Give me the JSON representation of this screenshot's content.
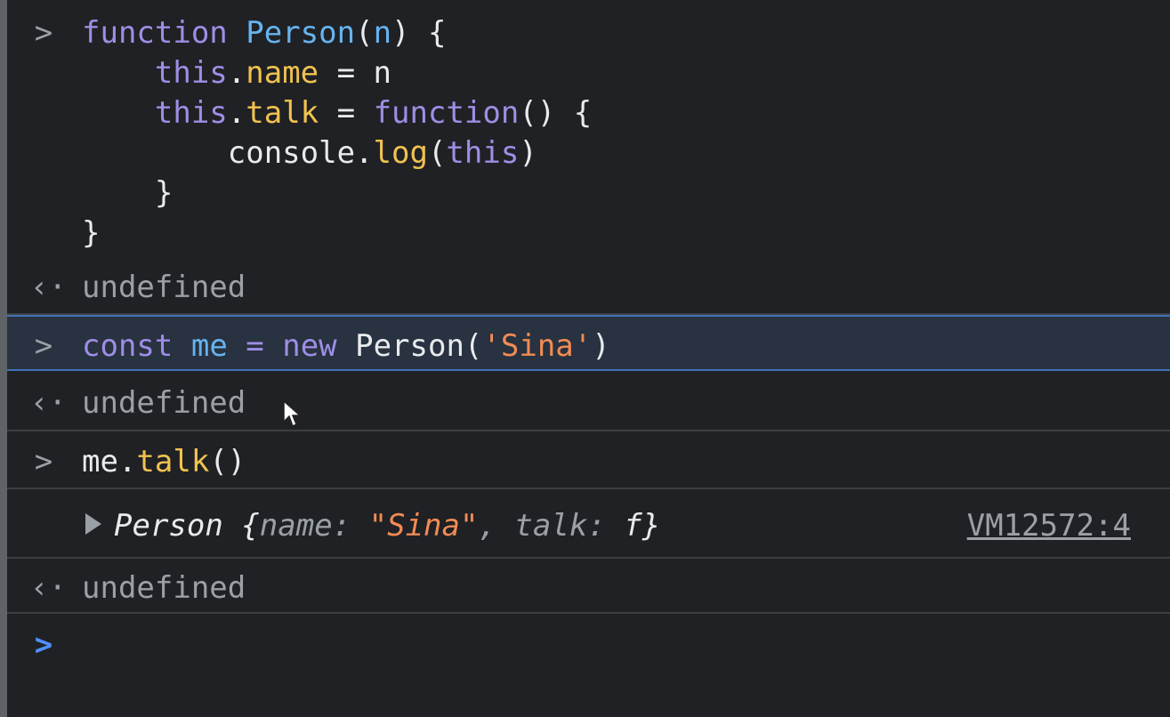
{
  "console": {
    "prompt_glyph": ">",
    "return_glyph": "‹·",
    "entries": [
      {
        "kind": "input",
        "lines": [
          [
            {
              "t": "function",
              "c": "kw"
            },
            {
              "t": " ",
              "c": "plain"
            },
            {
              "t": "Person",
              "c": "fn"
            },
            {
              "t": "(",
              "c": "plain"
            },
            {
              "t": "n",
              "c": "fn"
            },
            {
              "t": ") {",
              "c": "plain"
            }
          ],
          [
            {
              "t": "    this",
              "c": "kw"
            },
            {
              "t": ".",
              "c": "plain"
            },
            {
              "t": "name",
              "c": "prop"
            },
            {
              "t": " = n",
              "c": "plain"
            }
          ],
          [
            {
              "t": "    this",
              "c": "kw"
            },
            {
              "t": ".",
              "c": "plain"
            },
            {
              "t": "talk",
              "c": "prop"
            },
            {
              "t": " = ",
              "c": "plain"
            },
            {
              "t": "function",
              "c": "kw"
            },
            {
              "t": "() {",
              "c": "plain"
            }
          ],
          [
            {
              "t": "        console.",
              "c": "plain"
            },
            {
              "t": "log",
              "c": "prop"
            },
            {
              "t": "(",
              "c": "plain"
            },
            {
              "t": "this",
              "c": "kw"
            },
            {
              "t": ")",
              "c": "plain"
            }
          ],
          [
            {
              "t": "    }",
              "c": "plain"
            }
          ],
          [
            {
              "t": "}",
              "c": "plain"
            }
          ]
        ]
      },
      {
        "kind": "result",
        "text": "undefined"
      },
      {
        "kind": "input",
        "highlighted": true,
        "lines": [
          [
            {
              "t": "const",
              "c": "kw"
            },
            {
              "t": " ",
              "c": "plain"
            },
            {
              "t": "me",
              "c": "fn"
            },
            {
              "t": " = ",
              "c": "kw"
            },
            {
              "t": "new",
              "c": "kw"
            },
            {
              "t": " Person(",
              "c": "plain"
            },
            {
              "t": "'Sina'",
              "c": "str"
            },
            {
              "t": ")",
              "c": "plain"
            }
          ]
        ]
      },
      {
        "kind": "result",
        "text": "undefined"
      },
      {
        "kind": "input",
        "lines": [
          [
            {
              "t": "me.",
              "c": "plain"
            },
            {
              "t": "talk",
              "c": "prop"
            },
            {
              "t": "()",
              "c": "plain"
            }
          ]
        ]
      },
      {
        "kind": "log",
        "object_class": "Person",
        "open_brace": " {",
        "key1": "name",
        "colon1": ": ",
        "value1": "\"Sina\"",
        "comma": ", ",
        "key2": "talk",
        "colon2": ": ",
        "value2": "f",
        "close_brace": "}",
        "source_link": "VM12572:4"
      },
      {
        "kind": "result",
        "text": "undefined"
      }
    ],
    "active_prompt": ">"
  },
  "colors": {
    "background": "#202124",
    "keyword": "#9e8ee6",
    "identifier": "#66b3f0",
    "property": "#f0c250",
    "string": "#f28b54",
    "muted": "#9aa0a6",
    "highlight_border": "#3f74b8",
    "active_prompt": "#4d90fe"
  }
}
